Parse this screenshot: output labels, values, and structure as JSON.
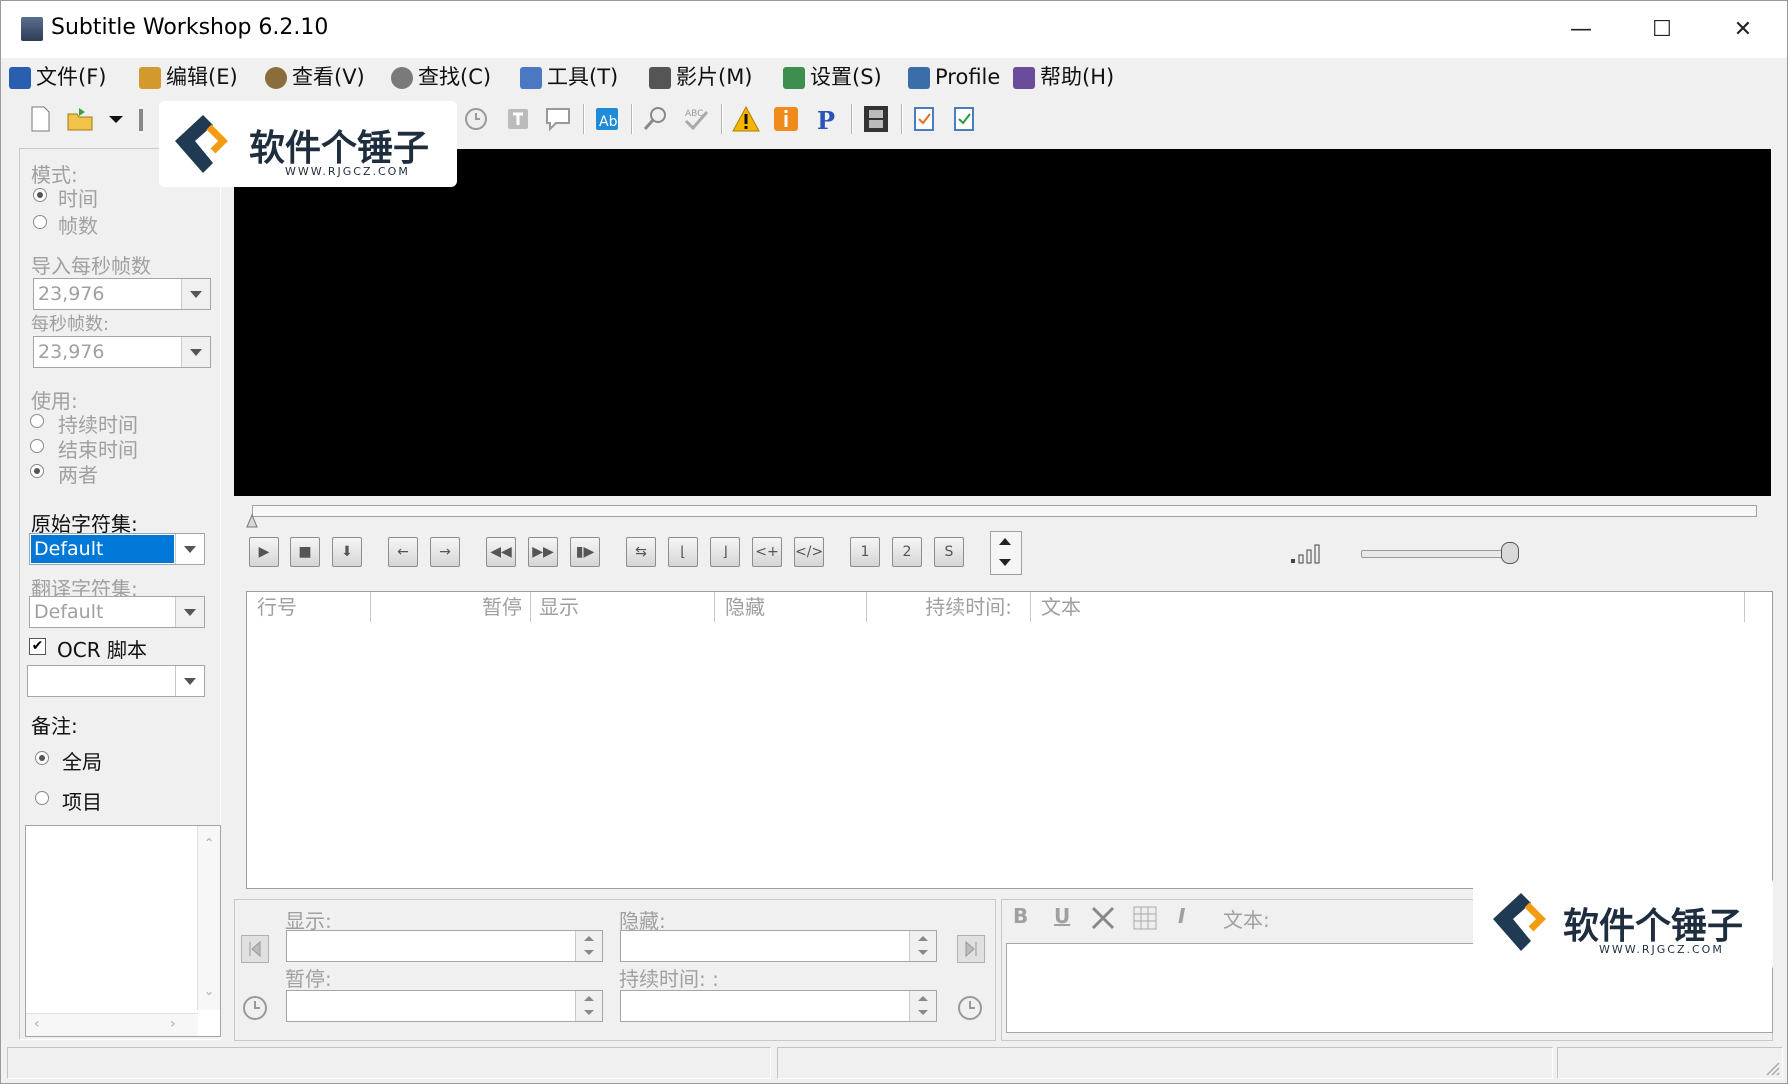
{
  "window": {
    "title": "Subtitle Workshop 6.2.10",
    "minimize": "—",
    "maximize": "☐",
    "close": "✕"
  },
  "menu": [
    {
      "label": "文件(F)",
      "icon": "save-icon",
      "color": "#2a5fb0"
    },
    {
      "label": "编辑(E)",
      "icon": "edit-icon",
      "color": "#d29a2c"
    },
    {
      "label": "查看(V)",
      "icon": "eye-icon",
      "color": "#8a6d3b"
    },
    {
      "label": "查找(C)",
      "icon": "find-icon",
      "color": "#7a7a7a"
    },
    {
      "label": "工具(T)",
      "icon": "wrench-icon",
      "color": "#4b78c2"
    },
    {
      "label": "影片(M)",
      "icon": "clapper-icon",
      "color": "#555555"
    },
    {
      "label": "设置(S)",
      "icon": "settings-icon",
      "color": "#3d8f4d"
    },
    {
      "label": "Profile",
      "icon": "profile-icon",
      "color": "#3b6ea8"
    },
    {
      "label": "帮助(H)",
      "icon": "help-book-icon",
      "color": "#6b4c9a"
    }
  ],
  "left": {
    "mode_label": "模式:",
    "mode_time": "时间",
    "mode_frames": "帧数",
    "input_fps_label": "导入每秒帧数",
    "input_fps_value": "23,976",
    "fps_label": "每秒帧数:",
    "fps_value": "23,976",
    "use_label": "使用:",
    "use_duration": "持续时间",
    "use_end": "结束时间",
    "use_both": "两者",
    "orig_charset_label": "原始字符集:",
    "orig_charset_value": "Default",
    "trans_charset_label": "翻译字符集:",
    "trans_charset_value": "Default",
    "ocr_label": "OCR 脚本",
    "ocr_checked": "✔",
    "notes_label": "备注:",
    "notes_global": "全局",
    "notes_item": "项目"
  },
  "grid": {
    "headers": [
      "行号",
      "暂停",
      "显示",
      "隐藏",
      "持续时间:",
      "文本"
    ]
  },
  "editor": {
    "show_label": "显示:",
    "hide_label": "隐藏:",
    "pause_label": "暂停:",
    "duration_label": "持续时间: :",
    "text_label": "文本:",
    "fmt_bold": "B",
    "fmt_underline": "U",
    "fmt_italic": "I"
  },
  "player": {
    "seek_fraction": 0.0,
    "volume_fraction": 1.0,
    "btn_1": "1",
    "btn_2": "2",
    "btn_s": "S"
  },
  "watermark": {
    "text": "软件个锤子",
    "url": "WWW.RJGCZ.COM"
  }
}
